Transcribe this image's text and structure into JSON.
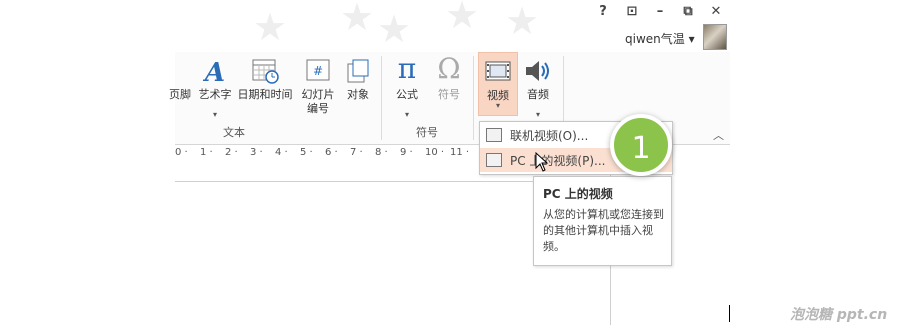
{
  "window": {
    "help_label": "?",
    "ribbon_display_label": "⊡",
    "minimize_label": "–",
    "restore_label": "⧉",
    "close_label": "✕",
    "user_name": "qiwen气温 ▾"
  },
  "ribbon": {
    "buttons": {
      "header_footer": "页脚",
      "wordart": "艺术字",
      "datetime": "日期和时间",
      "slide_number": "幻灯片\n编号",
      "object": "对象",
      "equation": "公式",
      "symbol": "符号",
      "video": "视频",
      "audio": "音频"
    },
    "groups": {
      "text": "文本",
      "symbols": "符号"
    }
  },
  "ruler": [
    "0",
    "1",
    "2",
    "3",
    "4",
    "5",
    "6",
    "7",
    "8",
    "9",
    "10",
    "11"
  ],
  "menu": {
    "online_video": "联机视频(O)...",
    "pc_video": "PC 上的视频(P)..."
  },
  "tooltip": {
    "title": "PC 上的视频",
    "body": "从您的计算机或您连接到的其他计算机中插入视频。"
  },
  "badge": {
    "step": "1"
  },
  "watermark": "泡泡糖 ppt.cn",
  "colors": {
    "accent_video": "#f9d5c3",
    "badge": "#8cc34a",
    "wordart_blue": "#2a6cb8"
  }
}
